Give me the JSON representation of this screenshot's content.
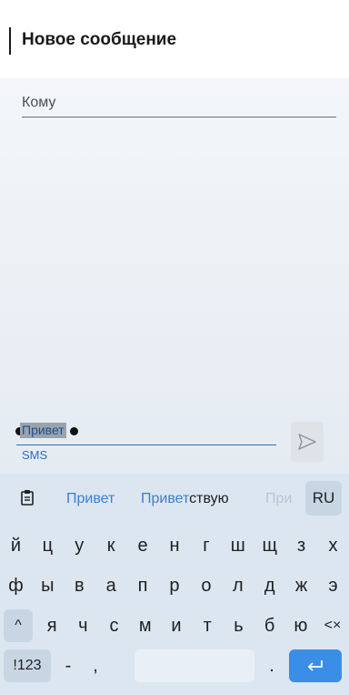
{
  "header": {
    "title": "Новое сообщение"
  },
  "to_field": {
    "label": "Кому"
  },
  "compose": {
    "selected_text": "Привет",
    "channel": "SMS"
  },
  "keyboard": {
    "suggestions": [
      "Привет",
      "Приветствую",
      "При"
    ],
    "suggestion2_typed": "Привет",
    "suggestion2_rest": "ствую",
    "language": "RU",
    "rows": [
      [
        "й",
        "ц",
        "у",
        "к",
        "е",
        "н",
        "г",
        "ш",
        "щ",
        "з",
        "х"
      ],
      [
        "ф",
        "ы",
        "в",
        "а",
        "п",
        "р",
        "о",
        "л",
        "д",
        "ж",
        "э"
      ],
      [
        "я",
        "ч",
        "с",
        "м",
        "и",
        "т",
        "ь",
        "б",
        "ю"
      ]
    ],
    "numbers_label": "!123",
    "dash": "-",
    "comma": ",",
    "period": ".",
    "shift_glyph": "^",
    "backspace_glyph": "<×"
  }
}
